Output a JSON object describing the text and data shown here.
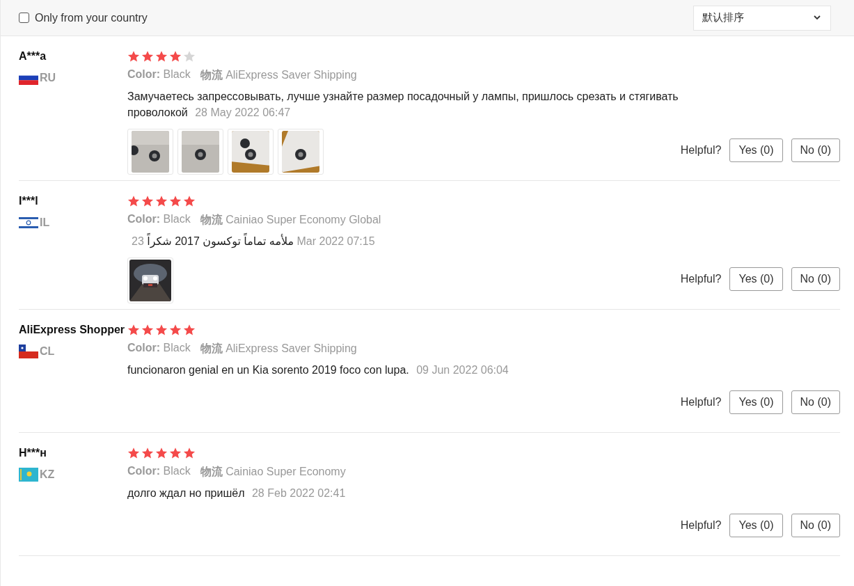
{
  "filter": {
    "label": "Only from your country",
    "checked": false
  },
  "sort": {
    "value": "默认排序"
  },
  "reviews": [
    {
      "name": "A***a",
      "flag": {
        "kind": "ru"
      },
      "country": "RU",
      "stars": 4,
      "color_label": "Color:",
      "color_value": "Black",
      "shipping_label": "物流",
      "shipping_value": "AliExpress Saver Shipping",
      "text": "Замучаетесь запрессовывать, лучше узнайте размер посадочный у лампы, пришлось срезать и стягивать проволокой",
      "date": "28 May 2022 06:47",
      "photos": [
        {
          "kind": "picture"
        },
        {
          "kind": "picture"
        },
        {
          "kind": "picture"
        },
        {
          "kind": "picture"
        }
      ],
      "helpful": "Helpful?",
      "yes": "Yes (0)",
      "no": "No (0)"
    },
    {
      "name": "I***l",
      "flag": {
        "kind": "il"
      },
      "country": "IL",
      "stars": 5,
      "color_label": "Color:",
      "color_value": "Black",
      "shipping_label": "物流",
      "shipping_value": "Cainiao Super Economy Global",
      "text": "ملأمه تماماً توكسون 2017 شكراً",
      "date": "23 Mar 2022 07:15",
      "photos": [
        {
          "kind": "picture"
        }
      ],
      "helpful": "Helpful?",
      "yes": "Yes (0)",
      "no": "No (0)"
    },
    {
      "name": "AliExpress Shopper",
      "flag": {
        "kind": "cl"
      },
      "country": "CL",
      "stars": 5,
      "color_label": "Color:",
      "color_value": "Black",
      "shipping_label": "物流",
      "shipping_value": "AliExpress Saver Shipping",
      "text": "funcionaron genial en un Kia sorento 2019 foco con lupa.",
      "date": "09 Jun 2022 06:04",
      "helpful": "Helpful?",
      "yes": "Yes (0)",
      "no": "No (0)"
    },
    {
      "name": "H***н",
      "flag": {
        "kind": "kz"
      },
      "country": "KZ",
      "stars": 5,
      "color_label": "Color:",
      "color_value": "Black",
      "shipping_label": "物流",
      "shipping_value": "Cainiao Super Economy",
      "text": "долго ждал но пришёл",
      "date": "28 Feb 2022 02:41",
      "helpful": "Helpful?",
      "yes": "Yes (0)",
      "no": "No (0)"
    }
  ]
}
